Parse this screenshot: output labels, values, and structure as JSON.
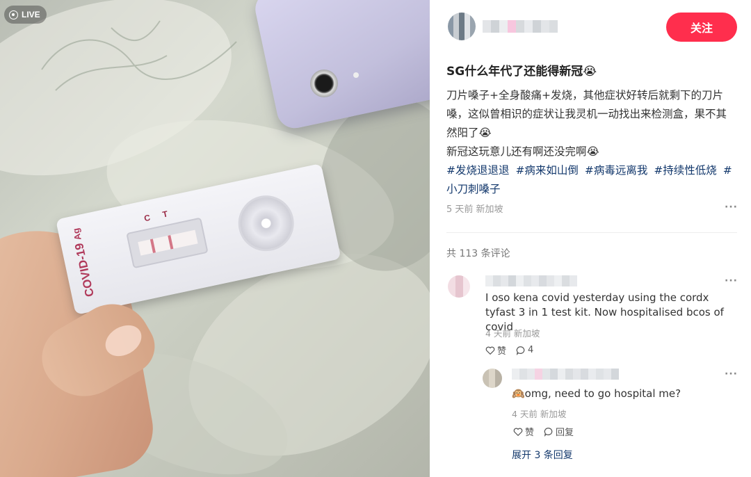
{
  "photo": {
    "live_label": "LIVE",
    "kit_label": "COVID-19",
    "kit_sublabel": "Ag",
    "kit_c": "C",
    "kit_t": "T"
  },
  "author": {
    "follow_label": "关注"
  },
  "post": {
    "title": "SG什么年代了还能得新冠😭",
    "body_line1": "刀片嗓子+全身酸痛+发烧，其他症状好转后就剩下的刀片嗓，这似曾相识的症状让我灵机一动找出来检测盒，果不其然阳了😭",
    "body_line2": "新冠这玩意儿还有啊还没完啊😭",
    "tags": [
      "#发烧退退退",
      "#病来如山倒",
      "#病毒远离我",
      "#持续性低烧",
      "#小刀刺嗓子"
    ],
    "meta": "5 天前 新加坡"
  },
  "comments_header": "共 113 条评论",
  "comments": [
    {
      "text": "I oso kena covid yesterday using the cordx tyfast 3 in 1 test kit. Now hospitalised bcos of covid",
      "meta": "4 天前 新加坡",
      "like_label": "赞",
      "reply_count": "4"
    },
    {
      "text": "🙉omg, need to go hospital me?",
      "meta": "4 天前 新加坡",
      "like_label": "赞",
      "reply_label": "回复"
    }
  ],
  "expand_label": "展开 3 条回复",
  "colors": {
    "accent": "#ff2e4d",
    "tag": "#13386c",
    "meta": "#999999"
  },
  "icons": [
    "live-icon",
    "more-icon",
    "heart-icon",
    "comment-icon"
  ]
}
